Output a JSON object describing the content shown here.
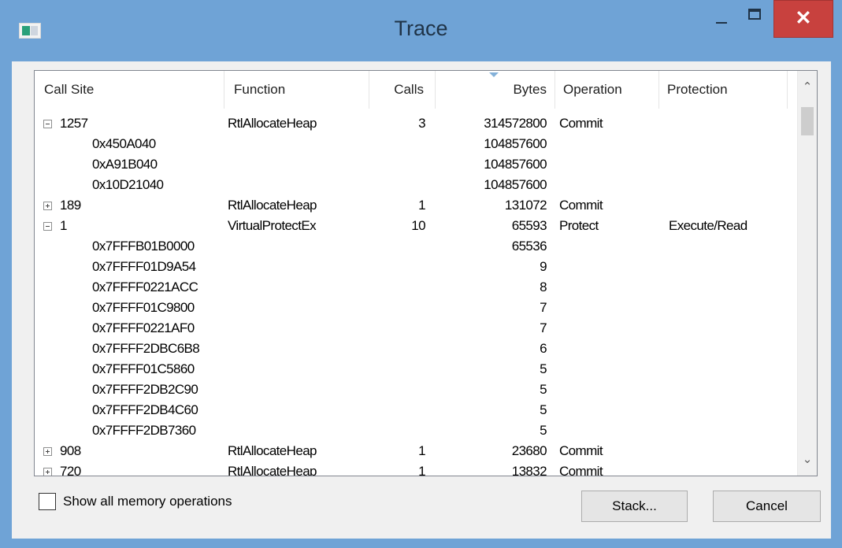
{
  "window": {
    "title": "Trace",
    "close_glyph": "✕"
  },
  "columns": {
    "call_site": "Call Site",
    "function": "Function",
    "calls": "Calls",
    "bytes": "Bytes",
    "operation": "Operation",
    "protection": "Protection"
  },
  "rows": [
    {
      "type": "group",
      "expanded": true,
      "call_site": "1257",
      "function": "RtlAllocateHeap",
      "calls": "3",
      "bytes": "314572800",
      "operation": "Commit",
      "protection": ""
    },
    {
      "type": "child",
      "call_site": "0x450A040",
      "bytes": "104857600"
    },
    {
      "type": "child",
      "call_site": "0xA91B040",
      "bytes": "104857600"
    },
    {
      "type": "child",
      "call_site": "0x10D21040",
      "bytes": "104857600"
    },
    {
      "type": "group",
      "expanded": false,
      "call_site": "189",
      "function": "RtlAllocateHeap",
      "calls": "1",
      "bytes": "131072",
      "operation": "Commit",
      "protection": ""
    },
    {
      "type": "group",
      "expanded": true,
      "call_site": "1",
      "function": "VirtualProtectEx",
      "calls": "10",
      "bytes": "65593",
      "operation": "Protect",
      "protection": "Execute/Read"
    },
    {
      "type": "child",
      "call_site": "0x7FFFB01B0000",
      "bytes": "65536"
    },
    {
      "type": "child",
      "call_site": "0x7FFFF01D9A54",
      "bytes": "9"
    },
    {
      "type": "child",
      "call_site": "0x7FFFF0221ACC",
      "bytes": "8"
    },
    {
      "type": "child",
      "call_site": "0x7FFFF01C9800",
      "bytes": "7"
    },
    {
      "type": "child",
      "call_site": "0x7FFFF0221AF0",
      "bytes": "7"
    },
    {
      "type": "child",
      "call_site": "0x7FFFF2DBC6B8",
      "bytes": "6"
    },
    {
      "type": "child",
      "call_site": "0x7FFFF01C5860",
      "bytes": "5"
    },
    {
      "type": "child",
      "call_site": "0x7FFFF2DB2C90",
      "bytes": "5"
    },
    {
      "type": "child",
      "call_site": "0x7FFFF2DB4C60",
      "bytes": "5"
    },
    {
      "type": "child",
      "call_site": "0x7FFFF2DB7360",
      "bytes": "5"
    },
    {
      "type": "group",
      "expanded": false,
      "call_site": "908",
      "function": "RtlAllocateHeap",
      "calls": "1",
      "bytes": "23680",
      "operation": "Commit",
      "protection": ""
    },
    {
      "type": "group",
      "expanded": false,
      "call_site": "720",
      "function": "RtlAllocateHeap",
      "calls": "1",
      "bytes": "13832",
      "operation": "Commit",
      "protection": ""
    }
  ],
  "scrollbar": {
    "up_glyph": "⌃",
    "down_glyph": "⌄"
  },
  "footer": {
    "show_all_label": "Show all memory operations",
    "show_all_checked": false,
    "stack_button": "Stack...",
    "cancel_button": "Cancel"
  },
  "colors": {
    "frame": "#6fa3d6",
    "close": "#c8413e",
    "client": "#f0f0f0"
  }
}
